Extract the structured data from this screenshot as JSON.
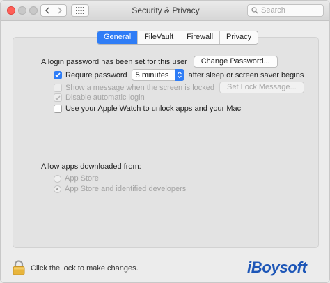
{
  "window": {
    "title": "Security & Privacy"
  },
  "search": {
    "placeholder": "Search"
  },
  "tabs": [
    {
      "label": "General",
      "active": true
    },
    {
      "label": "FileVault",
      "active": false
    },
    {
      "label": "Firewall",
      "active": false
    },
    {
      "label": "Privacy",
      "active": false
    }
  ],
  "general": {
    "login_text": "A login password has been set for this user",
    "change_password_label": "Change Password...",
    "require_password": {
      "label": "Require password",
      "checked": true,
      "selected_value": "5 minutes",
      "suffix": "after sleep or screen saver begins"
    },
    "show_message": {
      "label": "Show a message when the screen is locked",
      "checked": false,
      "disabled": true,
      "button_label": "Set Lock Message..."
    },
    "disable_auto_login": {
      "label": "Disable automatic login",
      "checked": true,
      "disabled": true
    },
    "apple_watch": {
      "label": "Use your Apple Watch to unlock apps and your Mac",
      "checked": false
    }
  },
  "downloads": {
    "heading": "Allow apps downloaded from:",
    "options": [
      {
        "label": "App Store",
        "selected": false
      },
      {
        "label": "App Store and identified developers",
        "selected": true
      }
    ]
  },
  "footer": {
    "lock_text": "Click the lock to make changes.",
    "watermark": "iBoysoft"
  },
  "colors": {
    "accent": "#2f7df6",
    "close": "#ff5f57",
    "brand": "#1d56b7"
  },
  "icons": [
    "back-icon",
    "forward-icon",
    "grid-icon",
    "search-icon",
    "checkmark-icon",
    "stepper-icon",
    "lock-icon"
  ]
}
